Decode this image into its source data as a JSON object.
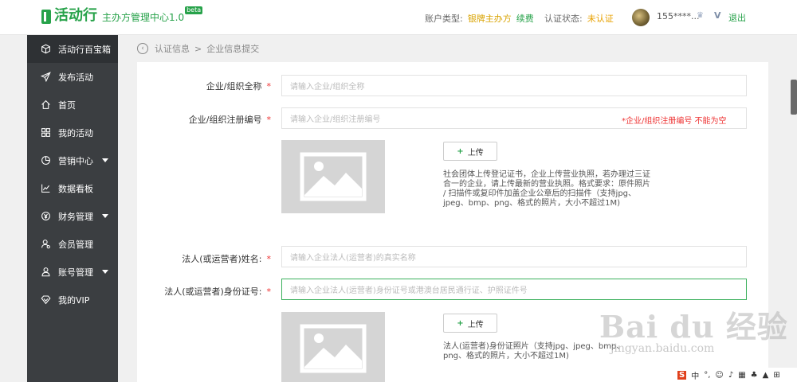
{
  "header": {
    "logo_name": "活动行",
    "logo_sub": "主办方管理中心1.0",
    "beta": "beta",
    "account_type_label": "账户类型:",
    "account_type_value": "银牌主办方",
    "renew": "续费",
    "cert_label": "认证状态:",
    "cert_value": "未认证",
    "phone": "155****...",
    "vip_mark": "V",
    "logout": "退出"
  },
  "sidebar": {
    "items": [
      {
        "label": "活动行百宝箱",
        "icon": "cube-icon"
      },
      {
        "label": "发布活动",
        "icon": "send-icon"
      },
      {
        "label": "首页",
        "icon": "home-icon"
      },
      {
        "label": "我的活动",
        "icon": "grid-icon"
      },
      {
        "label": "营销中心",
        "icon": "pie-icon"
      },
      {
        "label": "数据看板",
        "icon": "line-chart-icon"
      },
      {
        "label": "财务管理",
        "icon": "yen-icon"
      },
      {
        "label": "会员管理",
        "icon": "member-icon"
      },
      {
        "label": "账号管理",
        "icon": "user-icon"
      },
      {
        "label": "我的VIP",
        "icon": "diamond-icon"
      }
    ]
  },
  "breadcrumb": {
    "parent": "认证信息",
    "sep": ">",
    "current": "企业信息提交"
  },
  "form": {
    "org_name_label": "企业/组织全称",
    "org_name_placeholder": "请输入企业/组织全称",
    "org_reg_label": "企业/组织注册编号",
    "org_reg_placeholder": "请输入企业/组织注册编号",
    "org_reg_error": "*企业/组织注册编号 不能为空",
    "upload1_label": "上传",
    "upload1_note": "社会团体上传登记证书，企业上传营业执照，若办理过三证合一的企业，请上传最新的营业执照。格式要求：原件照片 / 扫描件或复印件加盖企业公章后的扫描件（支持jpg、jpeg、bmp、png、格式的照片，大小不超过1M)",
    "legal_name_label": "法人(或运营者)姓名:",
    "legal_name_placeholder": "请输入企业法人(运营者)的真实名称",
    "legal_id_label": "法人(或运营者)身份证号:",
    "legal_id_placeholder": "请输入企业法人(运营者)身份证号或港澳台居民通行证、护照证件号",
    "upload2_label": "上传",
    "upload2_note": "法人(运营者)身份证照片（支持jpg、jpeg、bmp、png、格式的照片，大小不超过1M)",
    "required_mark": "*"
  },
  "watermark": {
    "brand": "Bai du 经验",
    "url": "jingyan.baidu.com"
  },
  "ime": {
    "logo": "S",
    "mode": "中"
  },
  "colors": {
    "brand_green": "#27a24a",
    "sidebar_bg": "#3b3e41",
    "error_red": "#e33333",
    "focus_green": "#3bb05c"
  }
}
